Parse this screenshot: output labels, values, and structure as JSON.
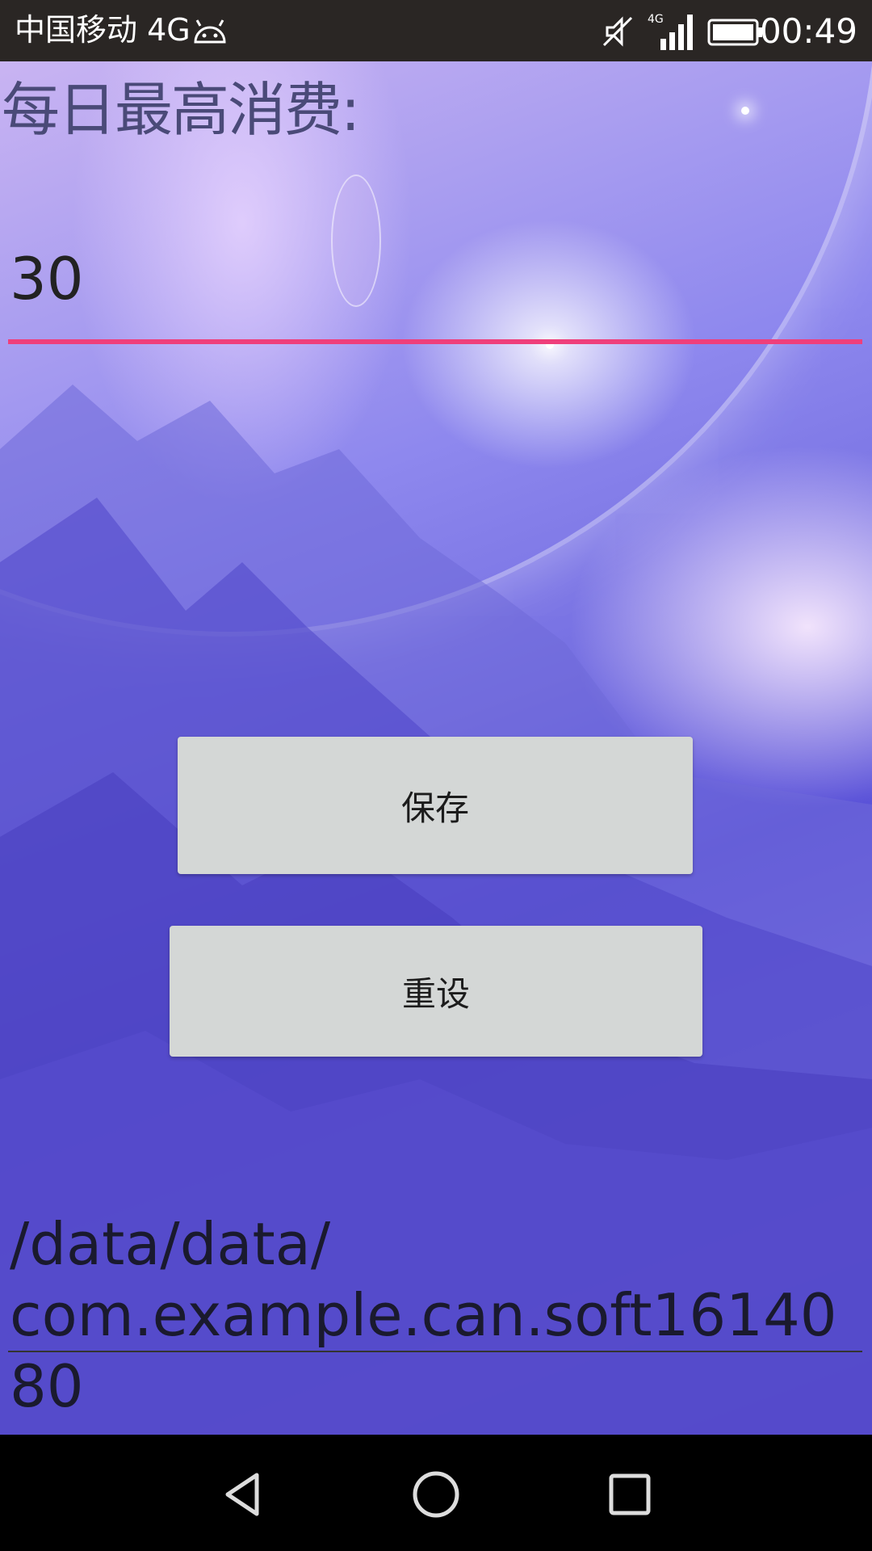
{
  "status_bar": {
    "carrier": "中国移动 4G",
    "network": "4G",
    "time": "00:49"
  },
  "form": {
    "limit_label": "每日最高消费:",
    "limit_value": "30",
    "save_label": "保存",
    "reset_label": "重设",
    "path_text": "/data/data/\ncom.example.can.soft1614080"
  },
  "colors": {
    "accent_underline": "#ef3f7b",
    "button_bg": "#d4d7d6"
  },
  "nav_bar": {
    "back_icon": "back-triangle-icon",
    "home_icon": "home-circle-icon",
    "recent_icon": "recent-square-icon"
  }
}
